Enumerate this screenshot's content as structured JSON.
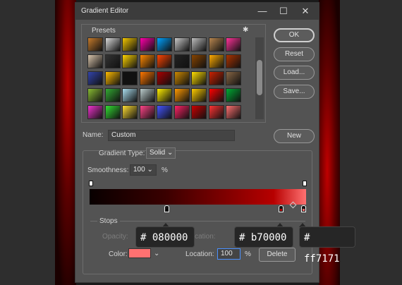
{
  "window": {
    "title": "Gradient Editor",
    "minimize": "—",
    "maximize": "☐",
    "close": "✕"
  },
  "presets": {
    "label": "Presets",
    "gear": "✱",
    "swatch_rows": [
      [
        "#c47a2b",
        "#d9d9d9",
        "#f2c600",
        "#ff00aa",
        "#00a2ff",
        "#c8c8c8",
        "#bdbdbd",
        "#b8864f",
        "#ff3399"
      ],
      [
        "#d7c3aa",
        "#333333",
        "#ffd400",
        "#ff8800",
        "#ff4400",
        "#222222",
        "#884400",
        "#ffaa00",
        "#aa3300"
      ],
      [
        "#3344aa",
        "#ffbb00",
        "#111111",
        "#ff7700",
        "#aa0000",
        "#cc8800",
        "#ffdd00",
        "#cc2200",
        "#886644"
      ],
      [
        "#88bb33",
        "#33aa33",
        "#aaddee",
        "#bbcccc",
        "#ffee00",
        "#ff9900",
        "#ffcc00",
        "#ff0000",
        "#00aa33"
      ],
      [
        "#ee33cc",
        "#33dd33",
        "#ffdd33",
        "#ff4488",
        "#4455ff",
        "#ff2266",
        "#cc0000",
        "#ff3333",
        "#ff7171"
      ]
    ]
  },
  "buttons": {
    "ok": "OK",
    "reset": "Reset",
    "load": "Load...",
    "save": "Save...",
    "new": "New",
    "delete": "Delete"
  },
  "name": {
    "label": "Name:",
    "value": "Custom"
  },
  "gradient": {
    "type_label": "Gradient Type:",
    "type_value": "Solid",
    "smoothness_label": "Smoothness:",
    "smoothness_value": "100",
    "smoothness_unit": "%"
  },
  "stops": {
    "label": "Stops",
    "opacity_label": "Opacity:",
    "opacity_location_label": "Location:",
    "color_label": "Color:",
    "color_value": "#ff7171",
    "location_label": "Location:",
    "location_value": "100",
    "location_unit": "%"
  },
  "tooltips": [
    "# 080000",
    "# b70000",
    "# ff7171"
  ],
  "colors": {
    "stop1": "#080000",
    "stop2": "#b70000",
    "stop3": "#ff7171"
  }
}
